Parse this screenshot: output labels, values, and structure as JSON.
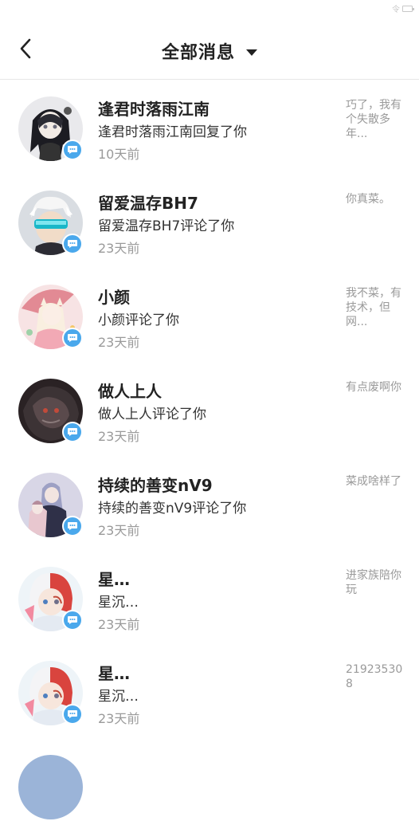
{
  "status": {
    "signal": "令",
    "battery": ""
  },
  "header": {
    "title": "全部消息"
  },
  "colors": {
    "badge": "#4aa8ec",
    "muted": "#9a9a9a"
  },
  "items": [
    {
      "name": "逢君时落雨江南",
      "action": "逢君时落雨江南回复了你",
      "time": "10天前",
      "preview": "巧了，我有个失散多年...",
      "avatar": "dark-gothic-girl"
    },
    {
      "name": "留爱温存BH7",
      "action": "留爱温存BH7评论了你",
      "time": "23天前",
      "preview": "你真菜。",
      "avatar": "white-hair-visor-boy"
    },
    {
      "name": "小颜",
      "action": "小颜评论了你",
      "time": "23天前",
      "preview": "我不菜，有技术，但网...",
      "avatar": "pink-umbrella-girl"
    },
    {
      "name": "做人上人",
      "action": "做人上人评论了你",
      "time": "23天前",
      "preview": "有点废啊你",
      "avatar": "dark-monster"
    },
    {
      "name": "持续的善变nV9",
      "action": "持续的善变nV9评论了你",
      "time": "23天前",
      "preview": "菜成啥样了",
      "avatar": "couple-in-rain"
    },
    {
      "name": "星…",
      "action": "星沉…",
      "time": "23天前",
      "preview": "进家族陪你玩",
      "avatar": "red-white-hair-boy"
    },
    {
      "name": "星…",
      "action": "星沉…",
      "time": "23天前",
      "preview": "219235308",
      "avatar": "red-white-hair-boy"
    }
  ]
}
